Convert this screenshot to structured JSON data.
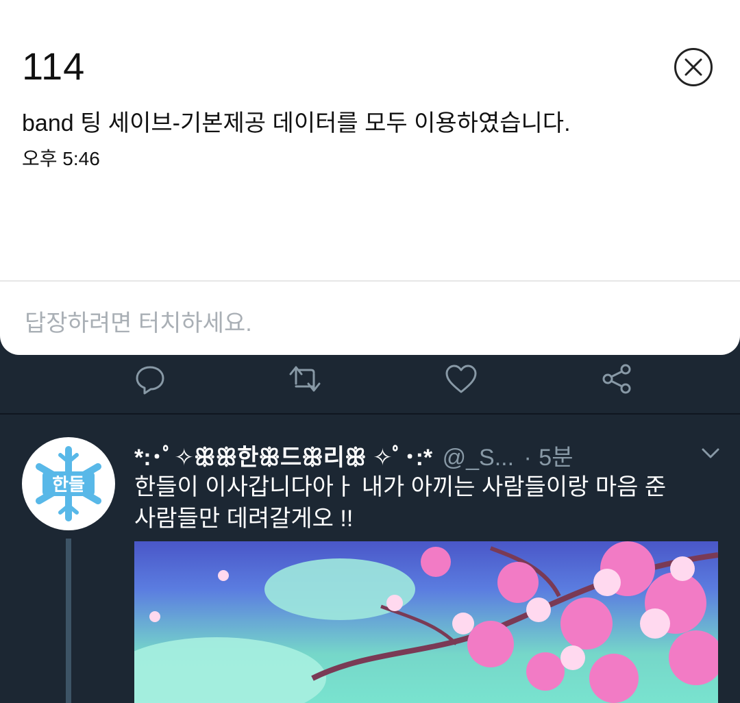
{
  "notification": {
    "title": "114",
    "body": "band 팅 세이브-기본제공 데이터를 모두 이용하였습니다.",
    "time": "오후 5:46",
    "reply_placeholder": "답장하려면 터치하세요."
  },
  "tweet_actions": [
    "reply-icon",
    "retweet-icon",
    "like-icon",
    "share-icon"
  ],
  "tweet": {
    "display_name": "*:･ﾟ✧ꕥꕥ한ꕥ드ꕥ리ꕥ ✧ﾟ･:*",
    "handle": "@_S...",
    "separator": "·",
    "time_ago": "5분",
    "text_line1": "한들이 이사갑니다아ㅏ 내가 아끼는 사람들이랑 마음 준",
    "text_line2": "사람들만 데려갈게오 !!",
    "avatar_label": "한들"
  },
  "colors": {
    "timeline_bg": "#1c2733",
    "secondary_text": "#8899a6",
    "avatar_snowflake": "#58b8e8"
  }
}
